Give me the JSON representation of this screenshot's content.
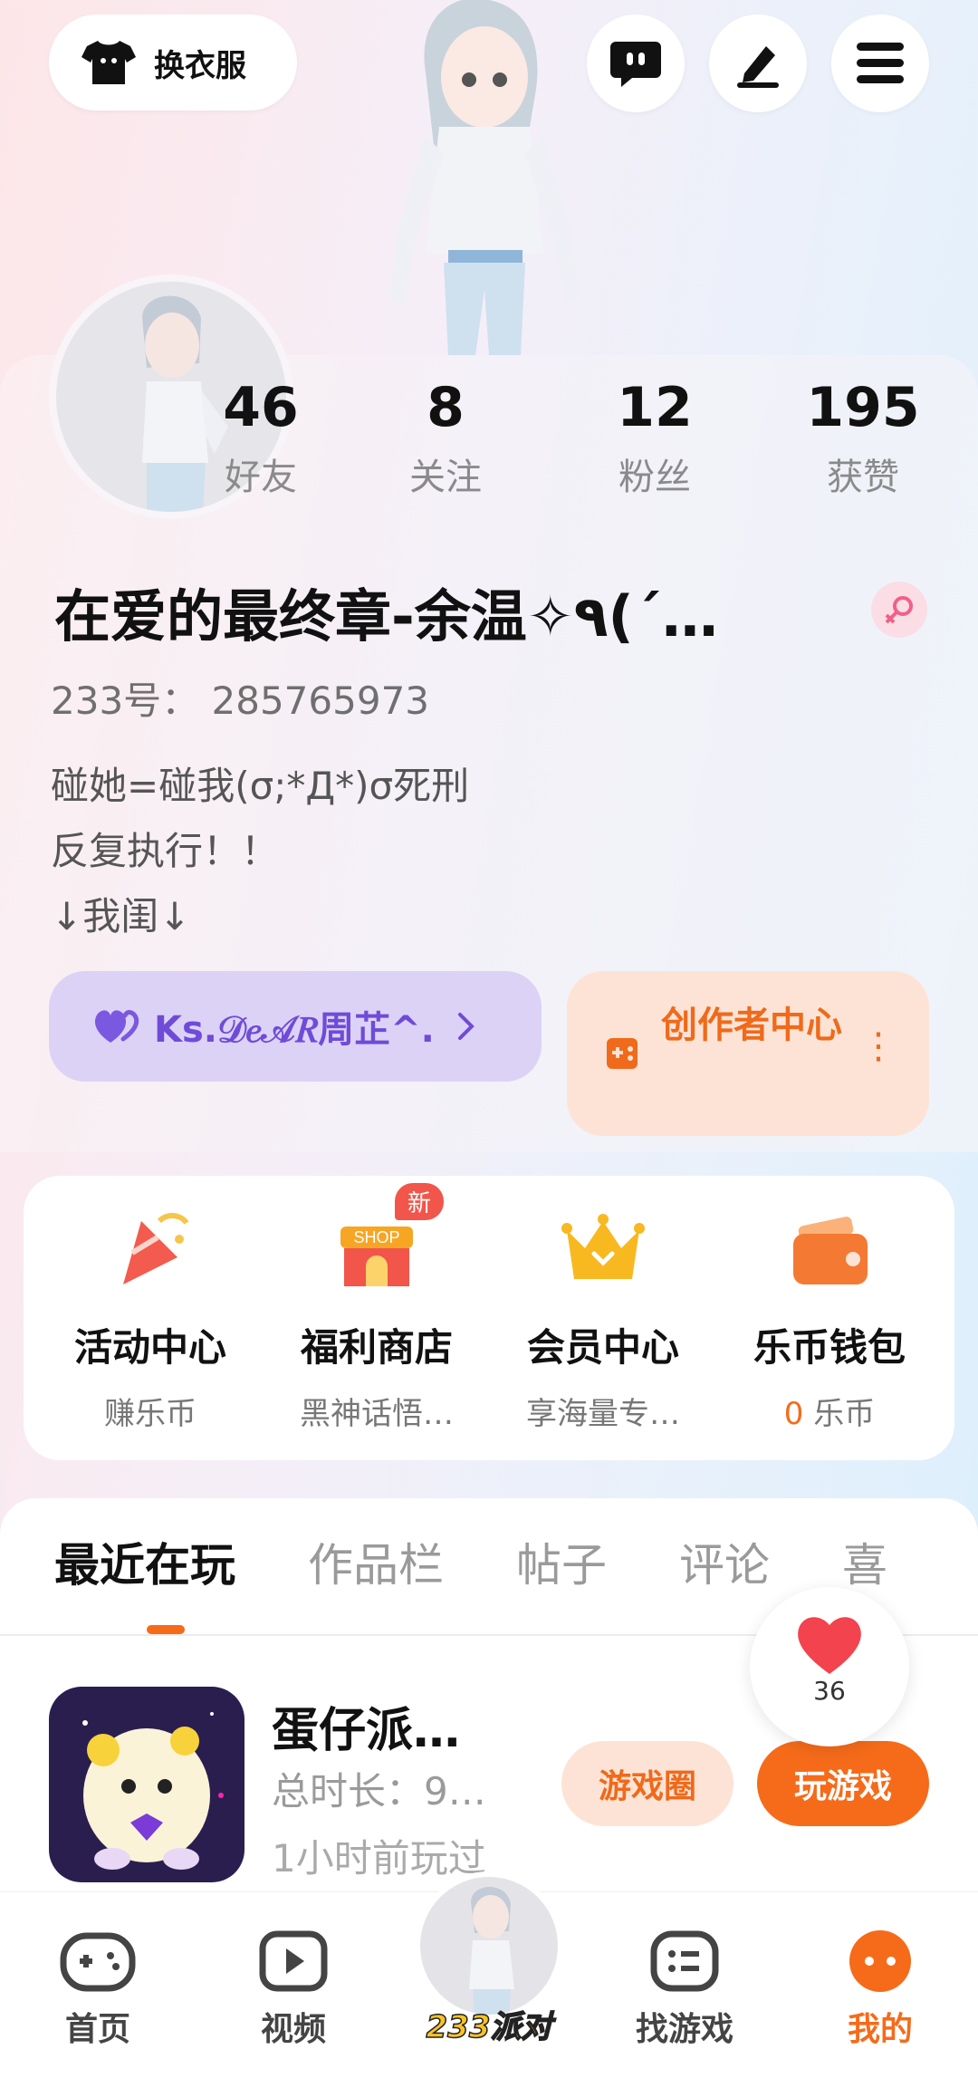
{
  "header": {
    "outfit_label": "换衣服"
  },
  "stats": [
    {
      "value": "46",
      "label": "好友"
    },
    {
      "value": "8",
      "label": "关注"
    },
    {
      "value": "12",
      "label": "粉丝"
    },
    {
      "value": "195",
      "label": "获赞"
    }
  ],
  "profile": {
    "nickname": "在爱的最终章-余温✧٩(ˊ…",
    "uid": "233号： 285765973",
    "bio_lines": [
      "碰她=碰我(σ;*Д*)σ死刑",
      "反复执行！！",
      "↓我闺↓"
    ],
    "ks_label": "Ks.𝒟𝑒𝒜𝑅周芷^.",
    "creator_label": "创作者中心",
    "creator_dots": "⋮"
  },
  "quick_actions": [
    {
      "title": "活动中心",
      "sub": "赚乐币"
    },
    {
      "title": "福利商店",
      "sub": "黑神话悟…",
      "badge": "新"
    },
    {
      "title": "会员中心",
      "sub": "享海量专…"
    },
    {
      "title": "乐币钱包",
      "sub_value": "0",
      "sub": "乐币"
    }
  ],
  "tabs": [
    "最近在玩",
    "作品栏",
    "帖子",
    "评论",
    "喜"
  ],
  "recent_game": {
    "name": "蛋仔派…",
    "time": "总时长：9…",
    "last_played": "1小时前玩过",
    "circle_button": "游戏圈",
    "play_button": "玩游戏"
  },
  "like": {
    "count": "36"
  },
  "nav": {
    "home": "首页",
    "video": "视频",
    "center": "233派对",
    "find": "找游戏",
    "mine": "我的"
  },
  "colors": {
    "accent": "#f56b1a",
    "creator_bg": "#fde3d6",
    "ks_bg": "#dcd2f6"
  }
}
